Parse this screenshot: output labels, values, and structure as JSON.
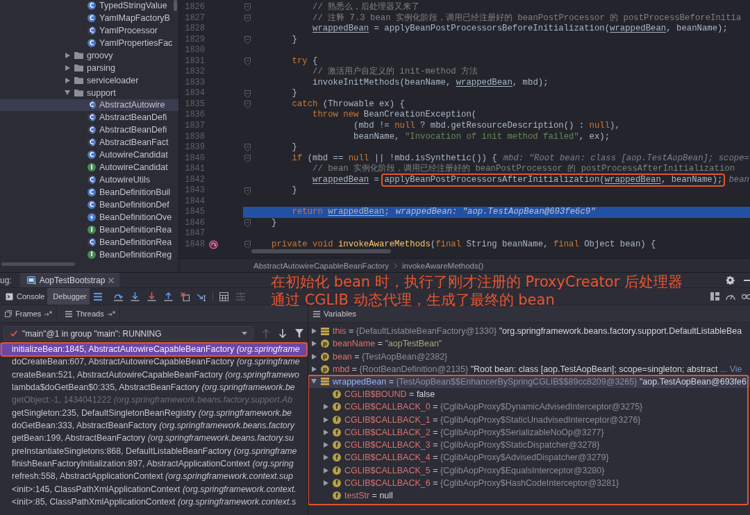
{
  "project_tree": {
    "continued_children": [
      {
        "label": "TypedStringValue",
        "kind": "class",
        "badge": "C",
        "selected": false
      },
      {
        "label": "YamlMapFactoryB",
        "kind": "class",
        "badge": "C",
        "selected": false
      },
      {
        "label": "YamlProcessor",
        "kind": "abstract",
        "badge": "C",
        "selected": false
      },
      {
        "label": "YamlPropertiesFac",
        "kind": "class",
        "badge": "C",
        "selected": false
      }
    ],
    "items": [
      {
        "label": "groovy",
        "kind": "folder",
        "expanded": false,
        "selected": false
      },
      {
        "label": "parsing",
        "kind": "folder",
        "expanded": false,
        "selected": false
      },
      {
        "label": "serviceloader",
        "kind": "folder",
        "expanded": false,
        "selected": false
      },
      {
        "label": "support",
        "kind": "folder",
        "expanded": true,
        "selected": false,
        "children": [
          {
            "label": "AbstractAutowire",
            "kind": "abstract",
            "badge": "C",
            "selected": true
          },
          {
            "label": "AbstractBeanDefi",
            "kind": "abstract",
            "badge": "C",
            "selected": false
          },
          {
            "label": "AbstractBeanDefi",
            "kind": "abstract",
            "badge": "C",
            "selected": false
          },
          {
            "label": "AbstractBeanFact",
            "kind": "abstract",
            "badge": "C",
            "selected": false
          },
          {
            "label": "AutowireCandidat",
            "kind": "class",
            "badge": "C",
            "selected": false
          },
          {
            "label": "AutowireCandidat",
            "kind": "interface",
            "badge": "I",
            "selected": false
          },
          {
            "label": "AutowireUtils",
            "kind": "abstract",
            "badge": "C",
            "selected": false
          },
          {
            "label": "BeanDefinitionBuil",
            "kind": "class",
            "badge": "C",
            "selected": false
          },
          {
            "label": "BeanDefinitionDef",
            "kind": "class",
            "badge": "C",
            "selected": false
          },
          {
            "label": "BeanDefinitionOve",
            "kind": "exception",
            "selected": false
          },
          {
            "label": "BeanDefinitionRea",
            "kind": "interface",
            "badge": "I",
            "selected": false
          },
          {
            "label": "BeanDefinitionRea",
            "kind": "abstract",
            "badge": "C",
            "selected": false
          },
          {
            "label": "BeanDefinitionReg",
            "kind": "interface",
            "badge": "I",
            "selected": false
          }
        ]
      }
    ]
  },
  "editor": {
    "lines": [
      {
        "number": "1826",
        "fold": true,
        "recursive": false,
        "current": false,
        "parts": [
          {
            "kind": "code",
            "tokens": [
              {
                "kind": "comment",
                "text": "        // 熟悉么，后处理器又来了"
              }
            ]
          }
        ]
      },
      {
        "number": "1827",
        "fold": true,
        "recursive": false,
        "current": false,
        "parts": [
          {
            "kind": "code",
            "tokens": [
              {
                "kind": "comment",
                "text": "        // 注释 7.3 bean 实例化阶段，调用已经注册好的 beanPostProcessor 的 postProcessBeforeInitia"
              }
            ]
          }
        ]
      },
      {
        "number": "1828",
        "fold": false,
        "recursive": false,
        "current": false,
        "parts": [
          {
            "kind": "code",
            "tokens": [
              {
                "kind": "var",
                "text": "        wrappedBean"
              },
              {
                "kind": "plain",
                "text": " = applyBeanPostProcessorsBeforeInitialization("
              },
              {
                "kind": "var",
                "text": "wrappedBean"
              },
              {
                "kind": "plain",
                "text": ", beanName);"
              }
            ]
          }
        ]
      },
      {
        "number": "1829",
        "fold": true,
        "recursive": false,
        "current": false,
        "parts": [
          {
            "kind": "code",
            "tokens": [
              {
                "kind": "plain",
                "text": "    }"
              }
            ]
          }
        ]
      },
      {
        "number": "1830",
        "fold": false,
        "recursive": false,
        "current": false
      },
      {
        "number": "1831",
        "fold": true,
        "recursive": false,
        "current": false,
        "parts": [
          {
            "kind": "code",
            "tokens": [
              {
                "kind": "keyword",
                "text": "    try"
              },
              {
                "kind": "plain",
                "text": " {"
              }
            ]
          }
        ]
      },
      {
        "number": "1832",
        "fold": false,
        "recursive": false,
        "current": false,
        "parts": [
          {
            "kind": "code",
            "tokens": [
              {
                "kind": "comment",
                "text": "        // 激活用户自定义的 init-method 方法"
              }
            ]
          }
        ]
      },
      {
        "number": "1833",
        "fold": false,
        "recursive": false,
        "current": false,
        "parts": [
          {
            "kind": "code",
            "tokens": [
              {
                "kind": "plain",
                "text": "        invokeInitMethods(beanName, "
              },
              {
                "kind": "var",
                "text": "wrappedBean"
              },
              {
                "kind": "plain",
                "text": ", mbd);"
              }
            ]
          }
        ]
      },
      {
        "number": "1834",
        "fold": true,
        "recursive": false,
        "current": false,
        "parts": [
          {
            "kind": "code",
            "tokens": [
              {
                "kind": "plain",
                "text": "    }"
              }
            ]
          }
        ]
      },
      {
        "number": "1835",
        "fold": true,
        "recursive": false,
        "current": false,
        "parts": [
          {
            "kind": "code",
            "tokens": [
              {
                "kind": "keyword",
                "text": "    catch"
              },
              {
                "kind": "plain",
                "text": " (Throwable ex) {"
              }
            ]
          }
        ]
      },
      {
        "number": "1836",
        "fold": false,
        "recursive": false,
        "current": false,
        "parts": [
          {
            "kind": "code",
            "tokens": [
              {
                "kind": "keyword",
                "text": "        throw new"
              },
              {
                "kind": "plain",
                "text": " BeanCreationException("
              }
            ]
          }
        ]
      },
      {
        "number": "1837",
        "fold": false,
        "recursive": false,
        "current": false,
        "parts": [
          {
            "kind": "code",
            "tokens": [
              {
                "kind": "plain",
                "text": "                (mbd != "
              },
              {
                "kind": "keyword",
                "text": "null"
              },
              {
                "kind": "plain",
                "text": " ? mbd.getResourceDescription() : "
              },
              {
                "kind": "keyword",
                "text": "null"
              },
              {
                "kind": "plain",
                "text": "),"
              }
            ]
          }
        ]
      },
      {
        "number": "1838",
        "fold": false,
        "recursive": false,
        "current": false,
        "parts": [
          {
            "kind": "code",
            "tokens": [
              {
                "kind": "plain",
                "text": "                beanName, "
              },
              {
                "kind": "string",
                "text": "\"Invocation of init method failed\""
              },
              {
                "kind": "plain",
                "text": ", ex);"
              }
            ]
          }
        ]
      },
      {
        "number": "1839",
        "fold": true,
        "recursive": false,
        "current": false,
        "parts": [
          {
            "kind": "code",
            "tokens": [
              {
                "kind": "plain",
                "text": "    }"
              }
            ]
          }
        ]
      },
      {
        "number": "1840",
        "fold": true,
        "recursive": false,
        "current": false,
        "parts": [
          {
            "kind": "code",
            "tokens": [
              {
                "kind": "keyword",
                "text": "    if"
              },
              {
                "kind": "plain",
                "text": " (mbd == "
              },
              {
                "kind": "keyword",
                "text": "null"
              },
              {
                "kind": "plain",
                "text": " || !mbd.isSynthetic()) {"
              }
            ]
          },
          {
            "kind": "hint",
            "text": "mbd: \"Root bean: class [aop.TestAopBean]; scope="
          }
        ]
      },
      {
        "number": "1841",
        "fold": false,
        "recursive": false,
        "current": false,
        "parts": [
          {
            "kind": "code",
            "tokens": [
              {
                "kind": "comment",
                "text": "        // bean 实例化阶段，调用已经注册好的 beanPostProcessor 的 postProcessAfterInitialization"
              }
            ]
          }
        ]
      },
      {
        "number": "1842",
        "fold": false,
        "recursive": false,
        "current": false,
        "parts": [
          {
            "kind": "code",
            "tokens": [
              {
                "kind": "var",
                "text": "        wrappedBean"
              },
              {
                "kind": "plain",
                "text": " = "
              }
            ]
          },
          {
            "kind": "boxed",
            "tokens": [
              {
                "kind": "plain",
                "text": "applyBeanPostProcessorsAfterInitialization("
              },
              {
                "kind": "var",
                "text": "wrappedBean"
              },
              {
                "kind": "plain",
                "text": ", beanName);"
              }
            ]
          },
          {
            "kind": "hint",
            "text": "bean"
          }
        ]
      },
      {
        "number": "1843",
        "fold": true,
        "recursive": false,
        "current": false,
        "parts": [
          {
            "kind": "code",
            "tokens": [
              {
                "kind": "plain",
                "text": "    }"
              }
            ]
          }
        ]
      },
      {
        "number": "1844",
        "fold": false,
        "recursive": false,
        "current": false
      },
      {
        "number": "1845",
        "fold": false,
        "recursive": false,
        "current": true,
        "parts": [
          {
            "kind": "code",
            "tokens": [
              {
                "kind": "keyword",
                "text": "    return "
              },
              {
                "kind": "var",
                "text": "wrappedBean"
              },
              {
                "kind": "plain",
                "text": ";"
              }
            ]
          },
          {
            "kind": "hint",
            "text": "wrappedBean: \"aop.TestAopBean@693fe6c9\""
          }
        ]
      },
      {
        "number": "1846",
        "fold": true,
        "recursive": false,
        "current": false,
        "parts": [
          {
            "kind": "code",
            "tokens": [
              {
                "kind": "plain",
                "text": "}"
              }
            ]
          }
        ]
      },
      {
        "number": "1847",
        "fold": false,
        "recursive": false,
        "current": false
      },
      {
        "number": "1848",
        "fold": true,
        "recursive": true,
        "current": false,
        "parts": [
          {
            "kind": "code",
            "tokens": [
              {
                "kind": "keyword",
                "text": "private void "
              },
              {
                "kind": "method",
                "text": "invokeAwareMethods"
              },
              {
                "kind": "plain",
                "text": "("
              },
              {
                "kind": "keyword",
                "text": "final"
              },
              {
                "kind": "plain",
                "text": " String beanName, "
              },
              {
                "kind": "keyword",
                "text": "final"
              },
              {
                "kind": "plain",
                "text": " Object bean) {"
              }
            ]
          }
        ]
      }
    ],
    "breadcrumbs": [
      "AbstractAutowireCapableBeanFactory",
      "invokeAwareMethods()"
    ]
  },
  "debug": {
    "title": "ug:",
    "session_tab": {
      "label": "AopTestBootstrap"
    },
    "tabs": [
      {
        "label": "Console",
        "kind": "console",
        "selected": false
      },
      {
        "label": "Debugger",
        "kind": "debugger",
        "selected": true
      }
    ],
    "annotation_lines": [
      "在初始化 bean 时，执行了刚才注册的 ProxyCreator 后处理器",
      "通过 CGLIB 动态代理，生成了最终的 bean"
    ],
    "frames_panel": {
      "tabs": [
        {
          "label": "Frames",
          "kind": "frames"
        },
        {
          "label": "Threads",
          "kind": "threads"
        }
      ],
      "thread": {
        "value": "\"main\"@1 in group \"main\": RUNNING",
        "up_disabled": true,
        "down_disabled": false
      },
      "frames": [
        {
          "text": "initializeBean:1845, AbstractAutowireCapableBeanFactory *(org.springframe*",
          "selected": true,
          "dimmed": false,
          "outlined": true
        },
        {
          "text": "doCreateBean:607, AbstractAutowireCapableBeanFactory *(org.springframe*",
          "selected": false,
          "dimmed": false,
          "outlined": false
        },
        {
          "text": "createBean:521, AbstractAutowireCapableBeanFactory *(org.springframewo*",
          "selected": false,
          "dimmed": false,
          "outlined": false
        },
        {
          "text": "lambda$doGetBean$0:335, AbstractBeanFactory *(org.springframework.be*",
          "selected": false,
          "dimmed": false,
          "outlined": false
        },
        {
          "text": "getObject:-1, 1434041222 *(org.springframework.beans.factory.support.Ab*",
          "selected": false,
          "dimmed": true,
          "outlined": false
        },
        {
          "text": "getSingleton:235, DefaultSingletonBeanRegistry *(org.springframework.be*",
          "selected": false,
          "dimmed": false,
          "outlined": false
        },
        {
          "text": "doGetBean:333, AbstractBeanFactory *(org.springframework.beans.factory*",
          "selected": false,
          "dimmed": false,
          "outlined": false
        },
        {
          "text": "getBean:199, AbstractBeanFactory *(org.springframework.beans.factory.su*",
          "selected": false,
          "dimmed": false,
          "outlined": false
        },
        {
          "text": "preInstantiateSingletons:868, DefaultListableBeanFactory *(org.springframe*",
          "selected": false,
          "dimmed": false,
          "outlined": false
        },
        {
          "text": "finishBeanFactoryInitialization:897, AbstractApplicationContext *(org.spring*",
          "selected": false,
          "dimmed": false,
          "outlined": false
        },
        {
          "text": "refresh:558, AbstractApplicationContext *(org.springframework.context.sup*",
          "selected": false,
          "dimmed": false,
          "outlined": false
        },
        {
          "text": "<init>:145, ClassPathXmlApplicationContext *(org.springframework.context.*",
          "selected": false,
          "dimmed": false,
          "outlined": false
        },
        {
          "text": "<init>:85, ClassPathXmlApplicationContext *(org.springframework.context.s*",
          "selected": false,
          "dimmed": false,
          "outlined": false
        }
      ]
    },
    "variables_panel": {
      "title": "Variables",
      "variables": [
        {
          "name": "this",
          "operator": "=",
          "kind": "object",
          "expandable": true,
          "expanded": false,
          "selected": false,
          "outlined": false,
          "type": "{DefaultListableBeanFactory@1330}",
          "value": "\"org.springframework.beans.factory.support.DefaultListableBea"
        },
        {
          "name": "beanName",
          "operator": "=",
          "kind": "parameter",
          "badge": "p",
          "expandable": true,
          "expanded": false,
          "selected": false,
          "outlined": false,
          "string_value": "\"aopTestBean\""
        },
        {
          "name": "bean",
          "operator": "=",
          "kind": "parameter",
          "badge": "p",
          "expandable": true,
          "expanded": false,
          "selected": false,
          "outlined": false,
          "type": "{TestAopBean@2382}"
        },
        {
          "name": "mbd",
          "operator": "=",
          "kind": "parameter",
          "badge": "p",
          "expandable": true,
          "expanded": false,
          "selected": false,
          "outlined": false,
          "type": "{RootBeanDefinition@2135}",
          "value": "\"Root bean: class [aop.TestAopBean]; scope=singleton; abstract",
          "link": "... Vie"
        },
        {
          "name": "wrappedBean",
          "operator": "=",
          "kind": "object",
          "expandable": true,
          "expanded": true,
          "selected": true,
          "outlined": true,
          "type": "{TestAopBean$$EnhancerBySpringCGLIB$$89cc8209@3265}",
          "value": "\"aop.TestAopBean@693fe6",
          "children": [
            {
              "name": "CGLIB$BOUND",
              "operator": "=",
              "kind": "field",
              "badge": "f",
              "expandable": false,
              "selected": false,
              "value": "false"
            },
            {
              "name": "CGLIB$CALLBACK_0",
              "operator": "=",
              "kind": "field",
              "badge": "f",
              "expandable": true,
              "expanded": false,
              "selected": false,
              "type": "{CglibAopProxy$DynamicAdvisedInterceptor@3275}"
            },
            {
              "name": "CGLIB$CALLBACK_1",
              "operator": "=",
              "kind": "field",
              "badge": "f",
              "expandable": true,
              "expanded": false,
              "selected": false,
              "type": "{CglibAopProxy$StaticUnadvisedInterceptor@3276}"
            },
            {
              "name": "CGLIB$CALLBACK_2",
              "operator": "=",
              "kind": "field",
              "badge": "f",
              "expandable": true,
              "expanded": false,
              "selected": false,
              "type": "{CglibAopProxy$SerializableNoOp@3277}"
            },
            {
              "name": "CGLIB$CALLBACK_3",
              "operator": "=",
              "kind": "field",
              "badge": "f",
              "expandable": true,
              "expanded": false,
              "selected": false,
              "type": "{CglibAopProxy$StaticDispatcher@3278}"
            },
            {
              "name": "CGLIB$CALLBACK_4",
              "operator": "=",
              "kind": "field",
              "badge": "f",
              "expandable": true,
              "expanded": false,
              "selected": false,
              "type": "{CglibAopProxy$AdvisedDispatcher@3279}"
            },
            {
              "name": "CGLIB$CALLBACK_5",
              "operator": "=",
              "kind": "field",
              "badge": "f",
              "expandable": true,
              "expanded": false,
              "selected": false,
              "type": "{CglibAopProxy$EqualsInterceptor@3280}"
            },
            {
              "name": "CGLIB$CALLBACK_6",
              "operator": "=",
              "kind": "field",
              "badge": "f",
              "expandable": true,
              "expanded": false,
              "selected": false,
              "type": "{CglibAopProxy$HashCodeInterceptor@3281}"
            },
            {
              "name": "testStr",
              "operator": "=",
              "kind": "field",
              "badge": "f",
              "expandable": false,
              "selected": false,
              "value": "null"
            }
          ]
        }
      ]
    }
  }
}
